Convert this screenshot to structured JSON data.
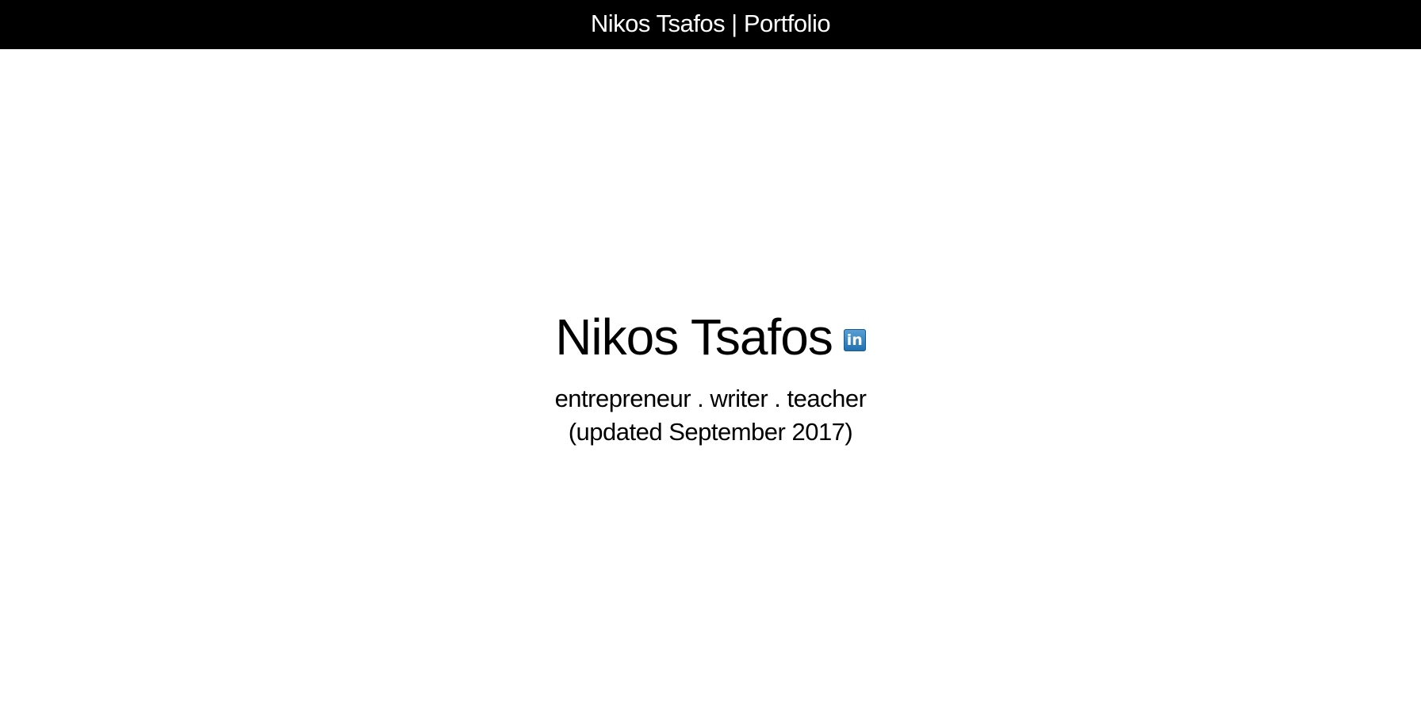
{
  "header": {
    "title": "Nikos Tsafos | Portfolio"
  },
  "hero": {
    "name": "Nikos Tsafos",
    "linkedin_label": "in",
    "tagline": "entrepreneur . writer . teacher",
    "updated": "(updated September 2017)"
  },
  "colors": {
    "topbar_bg": "#000000",
    "topbar_text": "#ffffff",
    "page_bg": "#ffffff",
    "linkedin_blue": "#2b7bb9"
  },
  "icons": {
    "linkedin": "linkedin-icon"
  }
}
